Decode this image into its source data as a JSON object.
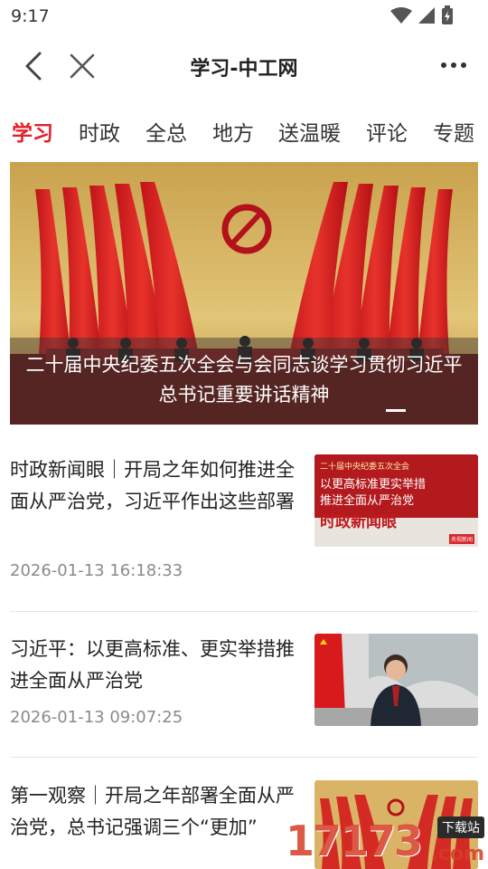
{
  "status_bar": {
    "time": "9:17"
  },
  "nav": {
    "title": "学习-中工网"
  },
  "tabs": [
    {
      "label": "学习",
      "active": true
    },
    {
      "label": "时政",
      "active": false
    },
    {
      "label": "全总",
      "active": false
    },
    {
      "label": "地方",
      "active": false
    },
    {
      "label": "送温暖",
      "active": false
    },
    {
      "label": "评论",
      "active": false
    },
    {
      "label": "专题",
      "active": false
    }
  ],
  "banner": {
    "caption": "二十届中央纪委五次全会与会同志谈学习贯彻习近平总书记重要讲话精神"
  },
  "news": [
    {
      "title": "时政新闻眼｜开局之年如何推进全面从严治党，习近平作出这些部署",
      "time": "2026-01-13 16:18:33",
      "thumb": {
        "line1": "二十届中央纪委五次全会",
        "line2": "以更高标准更实举措",
        "line3": "推进全面从严治党",
        "brand": "时政新闻眼",
        "badge": "央视新闻"
      }
    },
    {
      "title": "习近平：以更高标准、更实举措推进全面从严治党",
      "time": "2026-01-13 09:07:25"
    },
    {
      "title": "第一观察｜开局之年部署全面从严治党，总书记强调三个“更加”"
    }
  ],
  "watermark": {
    "number": "17173",
    "tag": "下载站",
    "domain": ".com"
  },
  "colors": {
    "accent": "#e3212b",
    "time_gray": "#8a8a8a",
    "divider": "#e6e6e6"
  }
}
